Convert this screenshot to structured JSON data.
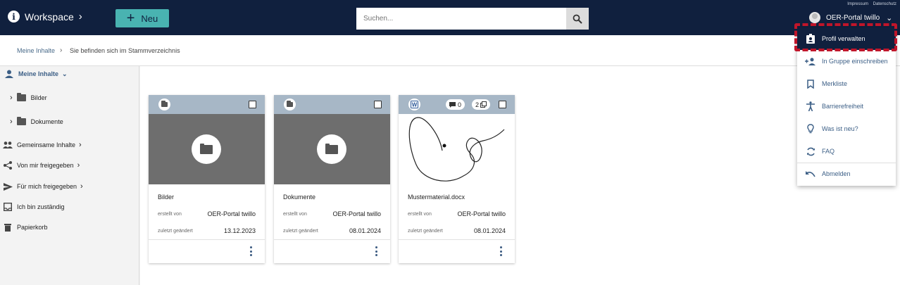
{
  "topbar": {
    "workspace_label": "Workspace",
    "new_button_label": "Neu",
    "search_placeholder": "Suchen...",
    "links": [
      "Impressum",
      "Datenschutz"
    ],
    "user_name": "OER-Portal twillo"
  },
  "breadcrumb": {
    "root": "Meine Inhalte",
    "current": "Sie befinden sich im Stammverzeichnis"
  },
  "sidebar": {
    "my_content": "Meine Inhalte",
    "folders": [
      "Bilder",
      "Dokumente"
    ],
    "shared": "Gemeinsame Inhalte",
    "shared_by_me": "Von mir freigegeben",
    "shared_with_me": "Für mich freigegeben",
    "responsible": "Ich bin zuständig",
    "trash": "Papierkorb"
  },
  "cards": [
    {
      "name": "Bilder",
      "created_by_label": "erstellt von",
      "created_by": "OER-Portal twillo",
      "modified_label": "zuletzt geändert",
      "modified": "13.12.2023"
    },
    {
      "name": "Dokumente",
      "created_by_label": "erstellt von",
      "created_by": "OER-Portal twillo",
      "modified_label": "zuletzt geändert",
      "modified": "08.01.2024"
    },
    {
      "name": "Mustermaterial.docx",
      "created_by_label": "erstellt von",
      "created_by": "OER-Portal twillo",
      "modified_label": "zuletzt geändert",
      "modified": "08.01.2024",
      "comments": "0",
      "versions": "2"
    }
  ],
  "user_menu": {
    "items": [
      "Profil verwalten",
      "In Gruppe einschreiben",
      "Merkliste",
      "Barrierefreiheit",
      "Was ist neu?",
      "FAQ",
      "Abmelden"
    ],
    "active": "Profil verwalten"
  },
  "colors": {
    "topbar": "#10203e",
    "accent": "#49b3b1",
    "highlight": "#c0152a",
    "card_header": "#a7b7c6"
  }
}
